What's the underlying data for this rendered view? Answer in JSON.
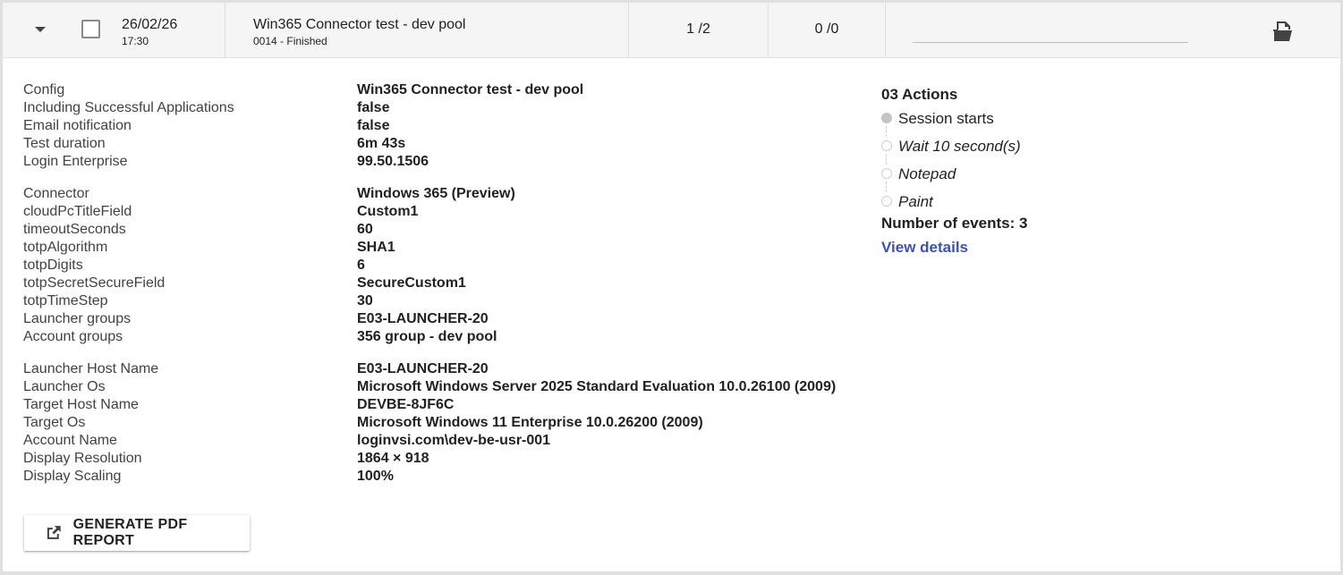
{
  "header": {
    "date": "26/02/26",
    "time": "17:30",
    "title": "Win365 Connector test - dev pool",
    "status": "0014 - Finished",
    "count_a": "1 /2",
    "count_b": "0 /0"
  },
  "details": {
    "groups": [
      [
        {
          "key": "Config",
          "value": "Win365 Connector test - dev pool"
        },
        {
          "key": "Including Successful Applications",
          "value": "false"
        },
        {
          "key": "Email notification",
          "value": "false"
        },
        {
          "key": "Test duration",
          "value": "6m 43s"
        },
        {
          "key": "Login Enterprise",
          "value": "99.50.1506"
        }
      ],
      [
        {
          "key": "Connector",
          "value": "Windows 365 (Preview)"
        },
        {
          "key": "cloudPcTitleField",
          "value": "Custom1"
        },
        {
          "key": "timeoutSeconds",
          "value": "60"
        },
        {
          "key": "totpAlgorithm",
          "value": "SHA1"
        },
        {
          "key": "totpDigits",
          "value": "6"
        },
        {
          "key": "totpSecretSecureField",
          "value": "SecureCustom1"
        },
        {
          "key": "totpTimeStep",
          "value": "30"
        },
        {
          "key": "Launcher groups",
          "value": "E03-LAUNCHER-20"
        },
        {
          "key": "Account groups",
          "value": "356 group - dev pool"
        }
      ],
      [
        {
          "key": "Launcher Host Name",
          "value": "E03-LAUNCHER-20"
        },
        {
          "key": "Launcher Os",
          "value": "Microsoft Windows Server 2025 Standard Evaluation 10.0.26100 (2009)"
        },
        {
          "key": "Target Host Name",
          "value": "DEVBE-8JF6C"
        },
        {
          "key": "Target Os",
          "value": "Microsoft Windows 11 Enterprise 10.0.26200 (2009)"
        },
        {
          "key": "Account Name",
          "value": "loginvsi.com\\dev-be-usr-001"
        },
        {
          "key": "Display Resolution",
          "value": "1864 × 918"
        },
        {
          "key": "Display Scaling",
          "value": "100%"
        }
      ]
    ]
  },
  "actions": {
    "title": "03 Actions",
    "items": [
      {
        "label": "Session starts",
        "italic": false,
        "filled": true
      },
      {
        "label": "Wait 10 second(s)",
        "italic": true,
        "filled": false
      },
      {
        "label": "Notepad",
        "italic": true,
        "filled": false
      },
      {
        "label": "Paint",
        "italic": true,
        "filled": false
      }
    ],
    "events": "Number of events: 3",
    "view_details": "View details"
  },
  "button": {
    "label": "GENERATE PDF REPORT",
    "icon": "open-external-icon"
  },
  "icons": {
    "expand": "chevron-down-icon",
    "pdf": "pdf-export-icon"
  },
  "colors": {
    "link": "#3f51b5",
    "header_bg": "#f5f5f5",
    "page_bg": "#e0e0e0"
  }
}
